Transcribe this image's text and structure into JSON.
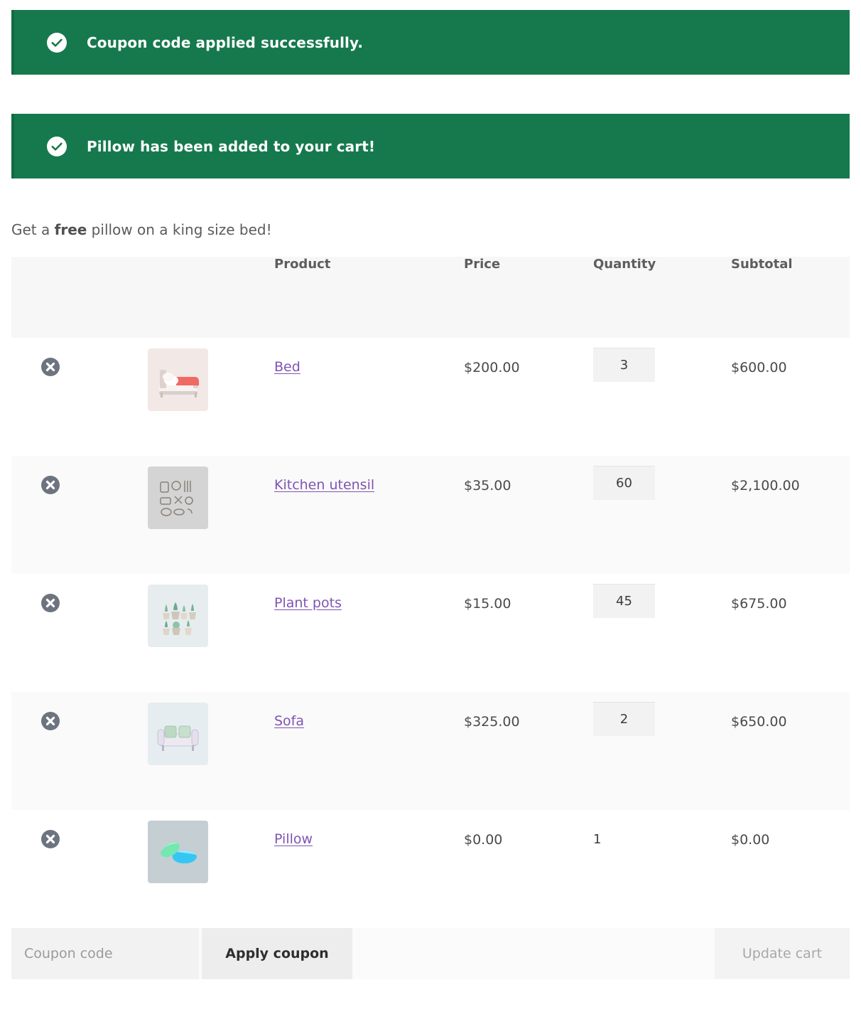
{
  "notices": [
    {
      "icon": "check-circle-icon",
      "message": "Coupon code applied successfully."
    },
    {
      "icon": "check-circle-icon",
      "message": "Pillow has been added to your cart!"
    }
  ],
  "promo": {
    "prefix": "Get a ",
    "emphasis": "free",
    "suffix": " pillow on a king size bed!"
  },
  "table": {
    "headers": {
      "remove": "",
      "thumbnail": "",
      "product": "Product",
      "price": "Price",
      "quantity": "Quantity",
      "subtotal": "Subtotal"
    },
    "rows": [
      {
        "remove_icon": "remove-circle-icon",
        "thumbnail": "bed-thumbnail",
        "name": "Bed",
        "price": "$200.00",
        "quantity": "3",
        "quantity_editable": true,
        "subtotal": "$600.00"
      },
      {
        "remove_icon": "remove-circle-icon",
        "thumbnail": "kitchen-utensil-thumbnail",
        "name": "Kitchen utensil",
        "price": "$35.00",
        "quantity": "60",
        "quantity_editable": true,
        "subtotal": "$2,100.00"
      },
      {
        "remove_icon": "remove-circle-icon",
        "thumbnail": "plant-pots-thumbnail",
        "name": "Plant pots",
        "price": "$15.00",
        "quantity": "45",
        "quantity_editable": true,
        "subtotal": "$675.00"
      },
      {
        "remove_icon": "remove-circle-icon",
        "thumbnail": "sofa-thumbnail",
        "name": "Sofa",
        "price": "$325.00",
        "quantity": "2",
        "quantity_editable": true,
        "subtotal": "$650.00"
      },
      {
        "remove_icon": "remove-circle-icon",
        "thumbnail": "pillow-thumbnail",
        "name": "Pillow",
        "price": "$0.00",
        "quantity": "1",
        "quantity_editable": false,
        "subtotal": "$0.00"
      }
    ]
  },
  "actions": {
    "coupon_placeholder": "Coupon code",
    "coupon_value": "",
    "apply_label": "Apply coupon",
    "update_label": "Update cart",
    "update_disabled": true
  },
  "colors": {
    "notice_green": "#16794d",
    "link_purple": "#7f54b3",
    "header_bg": "#f7f7f7",
    "remove_gray": "#6d7480"
  }
}
